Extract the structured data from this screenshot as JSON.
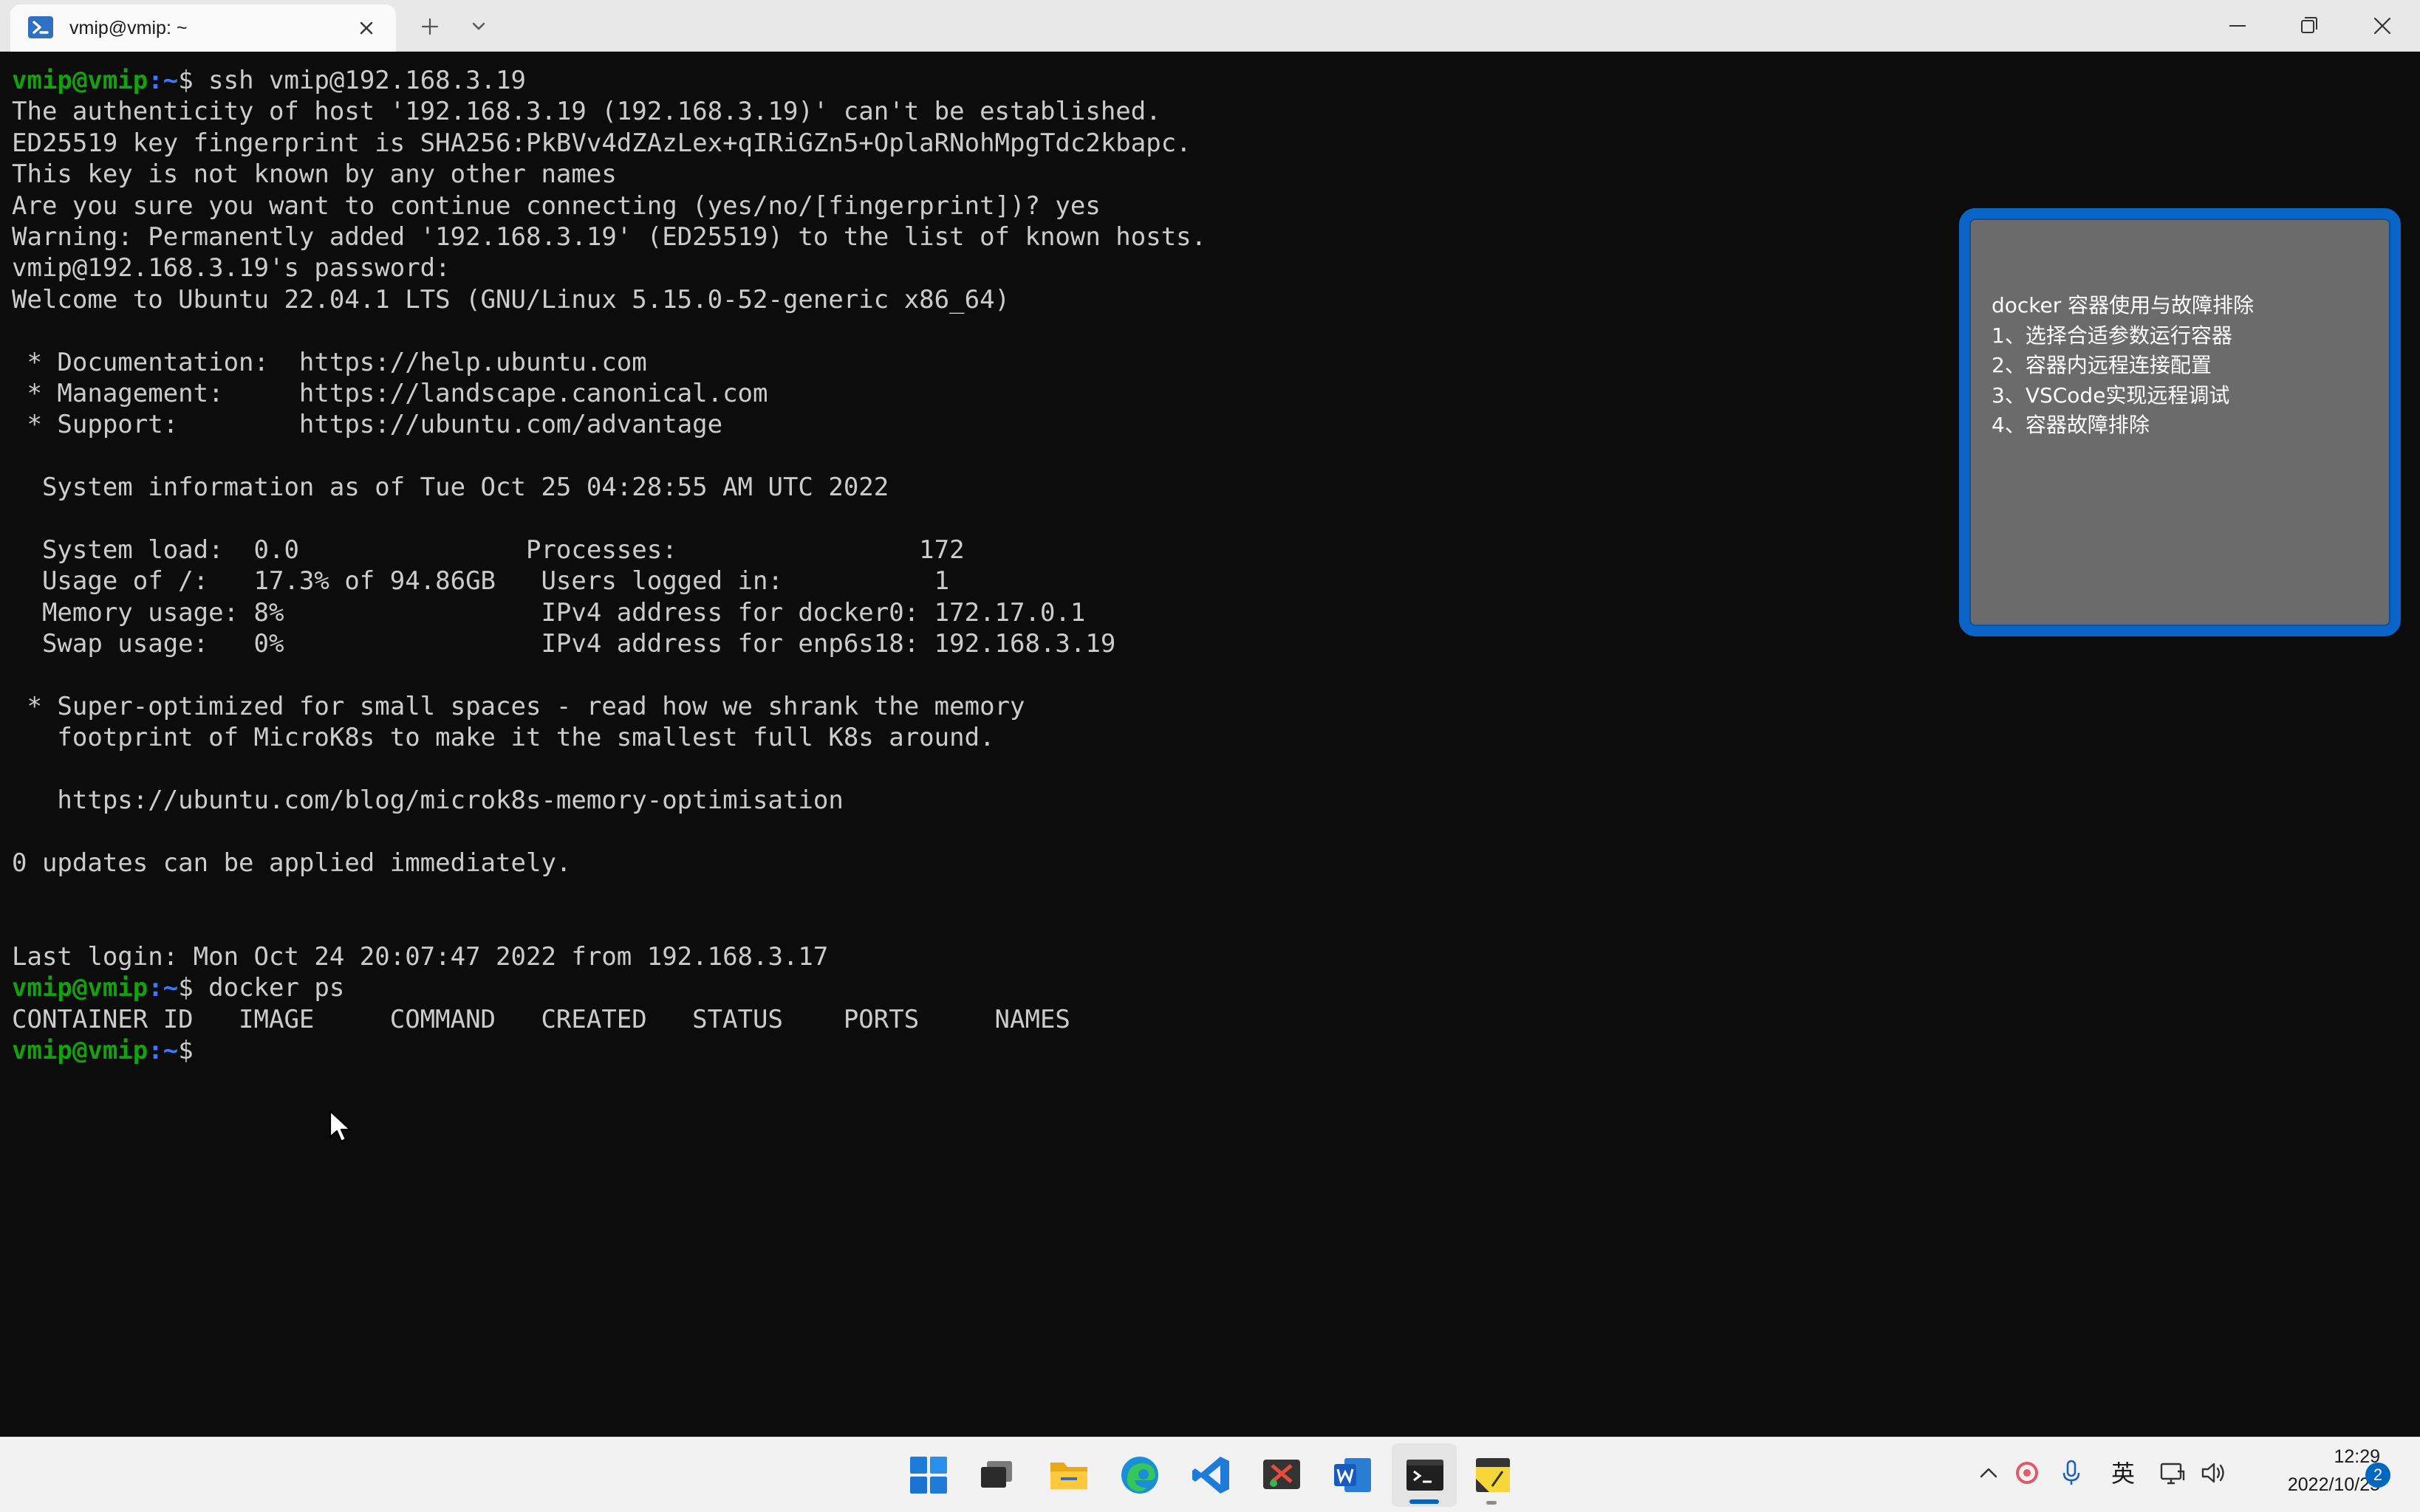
{
  "window": {
    "tab_title": "vmip@vmip: ~",
    "icons": [
      "powershell-tab-icon",
      "close-icon",
      "plus-icon",
      "chevron-down-icon",
      "minimize-icon",
      "restore-icon",
      "window-close-icon"
    ]
  },
  "terminal": {
    "prompt_user": "vmip@vmip",
    "prompt_path": ":~",
    "prompt_sign": "$ ",
    "lines": [
      {
        "type": "prompt",
        "command": "ssh vmip@192.168.3.19"
      },
      {
        "type": "output",
        "text": "The authenticity of host '192.168.3.19 (192.168.3.19)' can't be established."
      },
      {
        "type": "output",
        "text": "ED25519 key fingerprint is SHA256:PkBVv4dZAzLex+qIRiGZn5+OplaRNohMpgTdc2kbapc."
      },
      {
        "type": "output",
        "text": "This key is not known by any other names"
      },
      {
        "type": "output",
        "text": "Are you sure you want to continue connecting (yes/no/[fingerprint])? yes"
      },
      {
        "type": "output",
        "text": "Warning: Permanently added '192.168.3.19' (ED25519) to the list of known hosts."
      },
      {
        "type": "output",
        "text": "vmip@192.168.3.19's password:"
      },
      {
        "type": "output",
        "text": "Welcome to Ubuntu 22.04.1 LTS (GNU/Linux 5.15.0-52-generic x86_64)"
      },
      {
        "type": "output",
        "text": ""
      },
      {
        "type": "output",
        "text": " * Documentation:  https://help.ubuntu.com"
      },
      {
        "type": "output",
        "text": " * Management:     https://landscape.canonical.com"
      },
      {
        "type": "output",
        "text": " * Support:        https://ubuntu.com/advantage"
      },
      {
        "type": "output",
        "text": ""
      },
      {
        "type": "output",
        "text": "  System information as of Tue Oct 25 04:28:55 AM UTC 2022"
      },
      {
        "type": "output",
        "text": ""
      },
      {
        "type": "output",
        "text": "  System load:  0.0               Processes:                172"
      },
      {
        "type": "output",
        "text": "  Usage of /:   17.3% of 94.86GB   Users logged in:          1"
      },
      {
        "type": "output",
        "text": "  Memory usage: 8%                 IPv4 address for docker0: 172.17.0.1"
      },
      {
        "type": "output",
        "text": "  Swap usage:   0%                 IPv4 address for enp6s18: 192.168.3.19"
      },
      {
        "type": "output",
        "text": ""
      },
      {
        "type": "output",
        "text": " * Super-optimized for small spaces - read how we shrank the memory"
      },
      {
        "type": "output",
        "text": "   footprint of MicroK8s to make it the smallest full K8s around."
      },
      {
        "type": "output",
        "text": ""
      },
      {
        "type": "output",
        "text": "   https://ubuntu.com/blog/microk8s-memory-optimisation"
      },
      {
        "type": "output",
        "text": ""
      },
      {
        "type": "output",
        "text": "0 updates can be applied immediately."
      },
      {
        "type": "output",
        "text": ""
      },
      {
        "type": "output",
        "text": ""
      },
      {
        "type": "output",
        "text": "Last login: Mon Oct 24 20:07:47 2022 from 192.168.3.17"
      },
      {
        "type": "prompt",
        "command": "docker ps"
      },
      {
        "type": "output",
        "text": "CONTAINER ID   IMAGE     COMMAND   CREATED   STATUS    PORTS     NAMES"
      },
      {
        "type": "prompt",
        "command": ""
      }
    ],
    "colors": {
      "user": "#13a10e",
      "path": "#3b78ff",
      "text": "#cccccc",
      "background": "#0c0c0c"
    }
  },
  "note": {
    "lines": [
      "docker 容器使用与故障排除",
      "1、选择合适参数运行容器",
      "2、容器内远程连接配置",
      "3、VSCode实现远程调试",
      "4、容器故障排除"
    ],
    "border_color": "#0a64c8",
    "background": "#6b6b6b"
  },
  "taskbar": {
    "apps": [
      "windows-start-icon",
      "task-view-icon",
      "file-explorer-icon",
      "edge-icon",
      "vscode-icon",
      "snipping-tool-icon",
      "word-icon",
      "terminal-icon",
      "sticky-notes-icon"
    ],
    "tray": {
      "ime": "英",
      "icons": [
        "chevron-up-icon",
        "app-tray-icon",
        "microphone-icon",
        "network-icon",
        "volume-icon"
      ]
    },
    "clock": {
      "time": "12:29",
      "date": "2022/10/25"
    },
    "notification_count": "2"
  }
}
